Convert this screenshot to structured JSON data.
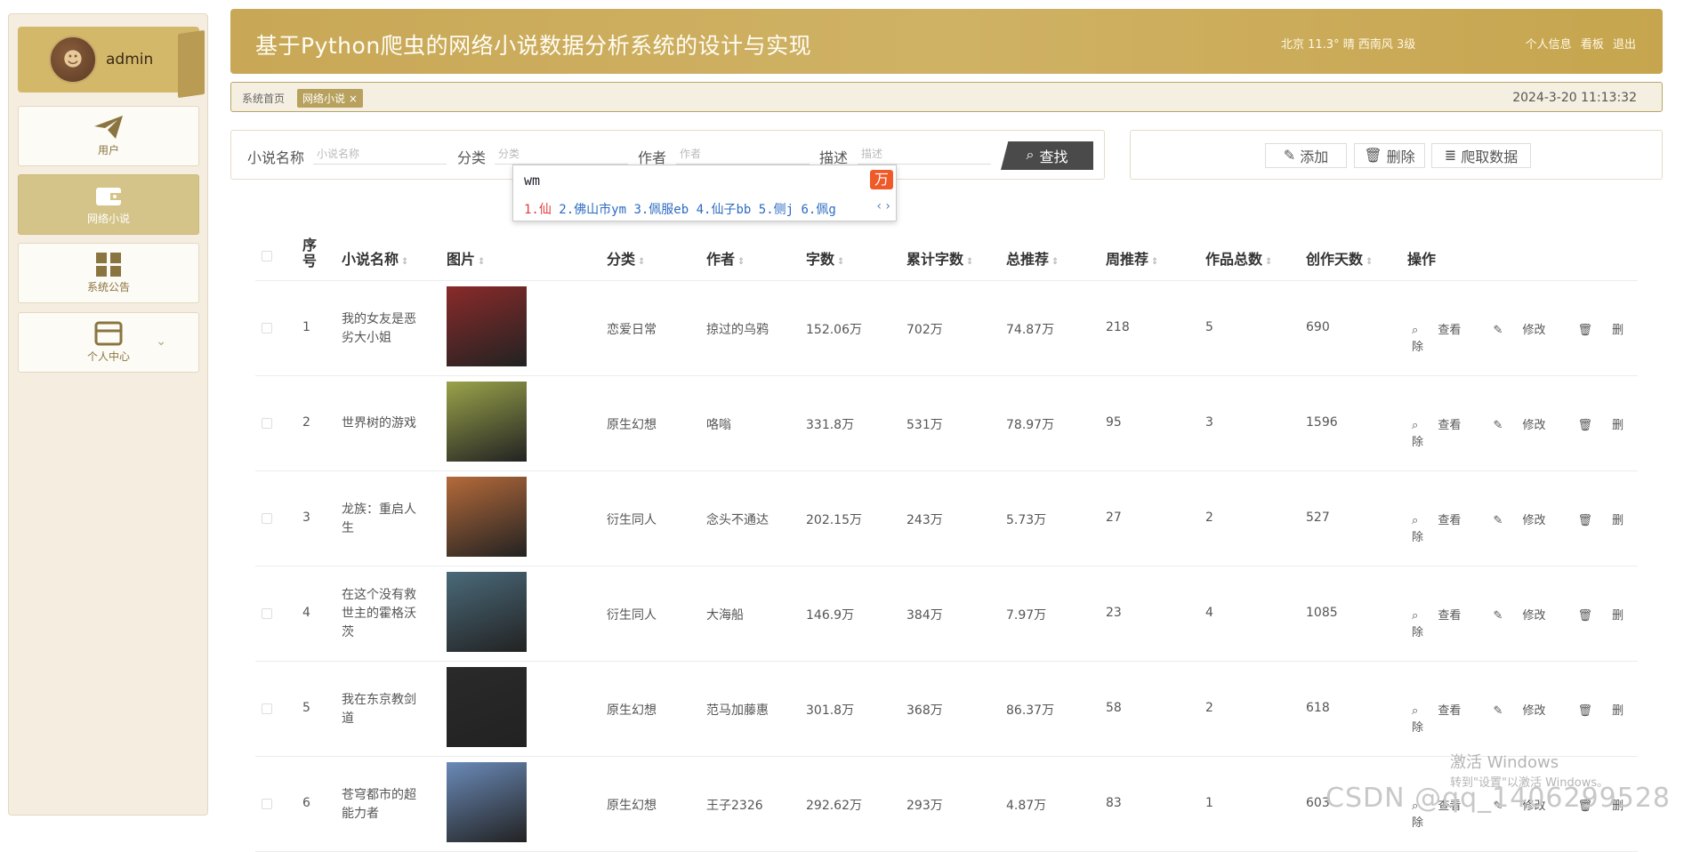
{
  "user": {
    "name": "admin"
  },
  "sidebar": {
    "items": [
      {
        "label": "用户",
        "icon": "paper-plane-icon"
      },
      {
        "label": "网络小说",
        "icon": "wallet-icon"
      },
      {
        "label": "系统公告",
        "icon": "grid-icon"
      },
      {
        "label": "个人中心",
        "icon": "card-icon"
      }
    ]
  },
  "header": {
    "title": "基于Python爬虫的网络小说数据分析系统的设计与实现",
    "weather": "北京  11.3°  晴  西南风  3级",
    "links": [
      "个人信息",
      "看板",
      "退出"
    ]
  },
  "breadcrumb": {
    "home": "系统首页",
    "tab": "网络小说 ×",
    "time": "2024-3-20 11:13:32"
  },
  "search": {
    "fields": [
      {
        "label": "小说名称",
        "placeholder": "小说名称"
      },
      {
        "label": "分类",
        "placeholder": "分类"
      },
      {
        "label": "作者",
        "placeholder": "作者"
      },
      {
        "label": "描述",
        "placeholder": "描述"
      }
    ],
    "button": "查找"
  },
  "actions": {
    "add": "添加",
    "delete": "删除",
    "crawl": "爬取数据"
  },
  "ime": {
    "input": "wm",
    "candidates": [
      "1.仙",
      "2.佛山市ym",
      "3.佩服eb",
      "4.仙子bb",
      "5.侧j",
      "6.佩g"
    ],
    "nav": "‹ ›"
  },
  "table": {
    "headers": [
      "序号",
      "小说名称",
      "图片",
      "分类",
      "作者",
      "字数",
      "累计字数",
      "总推荐",
      "周推荐",
      "作品总数",
      "创作天数",
      "操作"
    ],
    "ops": [
      "查看",
      "修改",
      "删除"
    ],
    "rows": [
      {
        "no": "1",
        "name": "我的女友是恶劣大小姐",
        "cat": "恋爱日常",
        "author": "掠过的乌鸦",
        "words": "152.06万",
        "total": "702万",
        "rec": "74.87万",
        "week": "218",
        "works": "5",
        "days": "690",
        "cover": "#8a2a2a"
      },
      {
        "no": "2",
        "name": "世界树的游戏",
        "cat": "原生幻想",
        "author": "咯嗡",
        "words": "331.8万",
        "total": "531万",
        "rec": "78.97万",
        "week": "95",
        "works": "3",
        "days": "1596",
        "cover": "#9aa34a"
      },
      {
        "no": "3",
        "name": "龙族：重启人生",
        "cat": "衍生同人",
        "author": "念头不通达",
        "words": "202.15万",
        "total": "243万",
        "rec": "5.73万",
        "week": "27",
        "works": "2",
        "days": "527",
        "cover": "#b56a3a"
      },
      {
        "no": "4",
        "name": "在这个没有救世主的霍格沃茨",
        "cat": "衍生同人",
        "author": "大海船",
        "words": "146.9万",
        "total": "384万",
        "rec": "7.97万",
        "week": "23",
        "works": "4",
        "days": "1085",
        "cover": "#4a6a7a"
      },
      {
        "no": "5",
        "name": "我在东京教剑道",
        "cat": "原生幻想",
        "author": "范马加藤惠",
        "words": "301.8万",
        "total": "368万",
        "rec": "86.37万",
        "week": "58",
        "works": "2",
        "days": "618",
        "cover": "#2a2a2a"
      },
      {
        "no": "6",
        "name": "苍穹都市的超能力者",
        "cat": "原生幻想",
        "author": "王子2326",
        "words": "292.62万",
        "total": "293万",
        "rec": "4.87万",
        "week": "83",
        "works": "1",
        "days": "603",
        "cover": "#6a8ab8"
      }
    ]
  },
  "watermark": {
    "line1": "激活 Windows",
    "line2": "转到\"设置\"以激活 Windows。",
    "csdn": "CSDN @qq_1406299528"
  }
}
